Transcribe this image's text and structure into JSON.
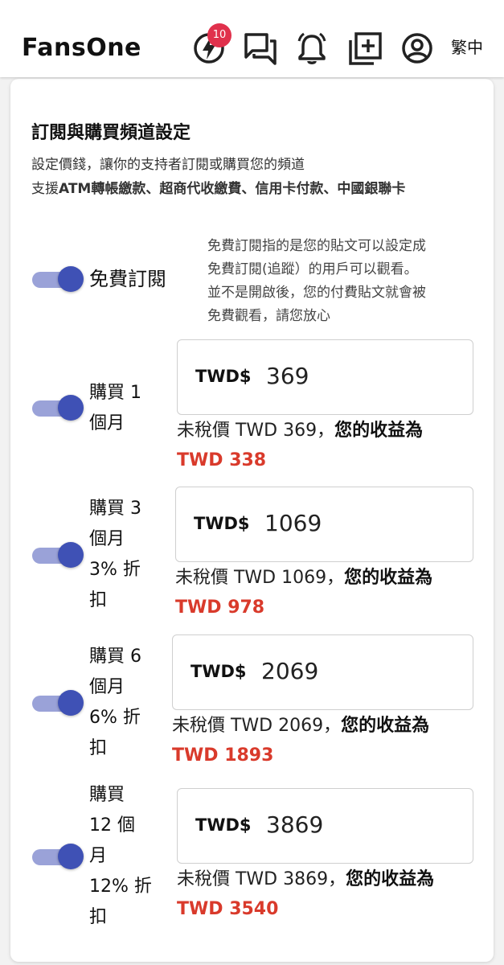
{
  "header": {
    "logo": "FansOne",
    "badge_count": "10",
    "lang": "繁中"
  },
  "section": {
    "title": "訂閱與購買頻道設定",
    "desc_line1": "設定價錢，讓你的支持者訂閱或購買您的頻道",
    "desc_line2_prefix": "支援",
    "desc_line2_bold": "ATM轉帳繳款、超商代收繳費、信用卡付款、中國銀聯卡"
  },
  "free": {
    "label": "免費訂閱",
    "enabled": true,
    "note": [
      "免費訂閱指的是您的貼文可以設定成",
      "免費訂閱(追蹤）的用戶可以觀看。",
      "並不是開啟後，您的付費貼文就會被",
      "免費觀看，請您放心"
    ]
  },
  "plans": [
    {
      "label_lines": [
        "購買 1",
        "個月"
      ],
      "enabled": true,
      "currency": "TWD$",
      "price": "369",
      "tax_text": "未稅價 TWD 369，",
      "earn_label": "您的收益為",
      "earn_value": "TWD 338"
    },
    {
      "label_lines": [
        "購買 3",
        "個月",
        "3% 折",
        "扣"
      ],
      "enabled": true,
      "currency": "TWD$",
      "price": "1069",
      "tax_text": "未稅價 TWD 1069，",
      "earn_label": "您的收益為",
      "earn_value": "TWD 978"
    },
    {
      "label_lines": [
        "購買 6",
        "個月",
        "6% 折",
        "扣"
      ],
      "enabled": true,
      "currency": "TWD$",
      "price": "2069",
      "tax_text": "未稅價 TWD 2069，",
      "earn_label": "您的收益為",
      "earn_value": "TWD 1893"
    },
    {
      "label_lines": [
        "購買",
        "12 個",
        "月",
        "12% 折",
        "扣"
      ],
      "enabled": true,
      "currency": "TWD$",
      "price": "3869",
      "tax_text": "未稅價 TWD 3869，",
      "earn_label": "您的收益為",
      "earn_value": "TWD 3540"
    }
  ],
  "colors": {
    "accent": "#3f51b5",
    "track": "#9aa2d8",
    "earn": "#d93a2b",
    "badge": "#e0314c"
  },
  "icons": [
    "lightning-icon",
    "chat-icon",
    "bell-icon",
    "add-box-icon",
    "account-icon"
  ]
}
